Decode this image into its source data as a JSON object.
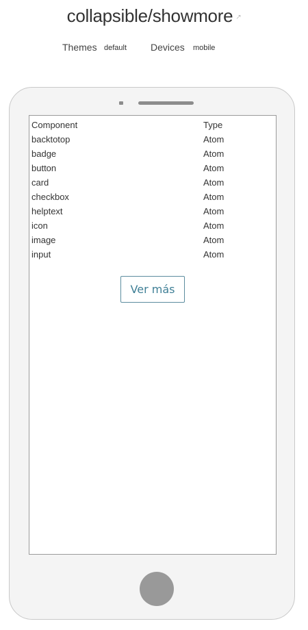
{
  "header": {
    "title": "collapsible/showmore",
    "themes_label": "Themes",
    "themes_value": "default",
    "devices_label": "Devices",
    "devices_value": "mobile"
  },
  "icons": {
    "title_link": "external-link-icon"
  },
  "table": {
    "headers": [
      "Component",
      "Type"
    ],
    "rows": [
      [
        "backtotop",
        "Atom"
      ],
      [
        "badge",
        "Atom"
      ],
      [
        "button",
        "Atom"
      ],
      [
        "card",
        "Atom"
      ],
      [
        "checkbox",
        "Atom"
      ],
      [
        "helptext",
        "Atom"
      ],
      [
        "icon",
        "Atom"
      ],
      [
        "image",
        "Atom"
      ],
      [
        "input",
        "Atom"
      ]
    ]
  },
  "show_more_label": "Ver más",
  "colors": {
    "button_border": "#5b8c9e",
    "button_text": "#3f7f96",
    "device_frame": "#f4f4f4",
    "home_button": "#999999"
  }
}
